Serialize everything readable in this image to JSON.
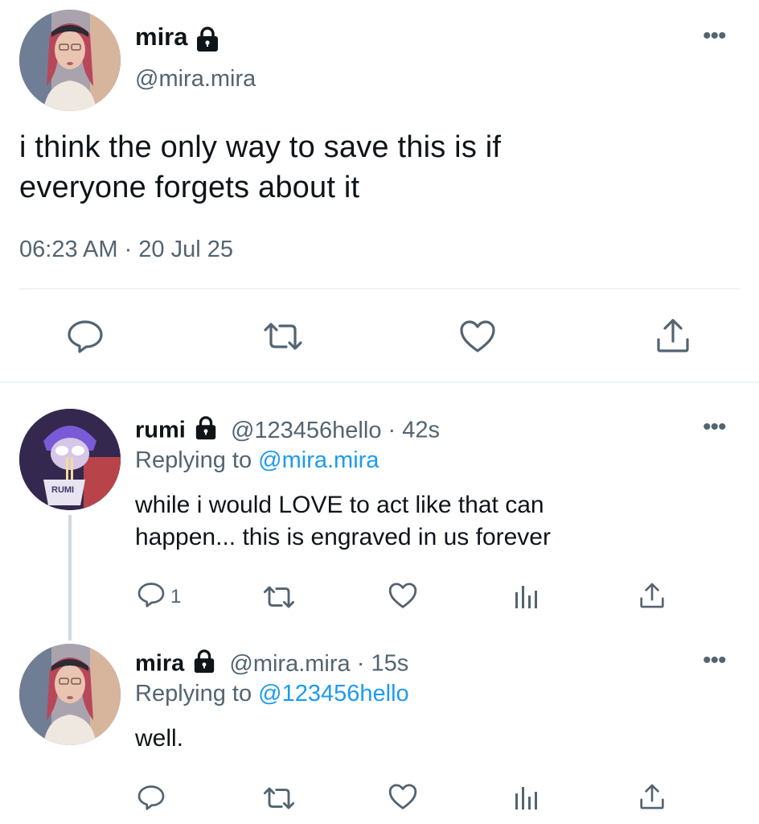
{
  "main_tweet": {
    "name": "mira",
    "handle": "@mira.mira",
    "text_line1": "i think the only way to save this is if",
    "text_line2": "everyone forgets about it",
    "timestamp": "06:23 AM · 20 Jul 25",
    "more": "•••",
    "icons": [
      "reply-icon",
      "retweet-icon",
      "like-icon",
      "share-icon"
    ]
  },
  "replies": [
    {
      "name": "rumi",
      "handle": "@123456hello",
      "time": "· 42s",
      "replying_prefix": "Replying to ",
      "replying_to": "@mira.mira",
      "text_line1": "while i would LOVE to act like that can",
      "text_line2": "happen... this is engraved in us forever",
      "reply_count": "1",
      "more": "•••",
      "avatar_label": "RUMI"
    },
    {
      "name": "mira",
      "handle": "@mira.mira",
      "time": "· 15s",
      "replying_prefix": "Replying to ",
      "replying_to": "@123456hello",
      "text_line1": "well.",
      "more": "•••"
    }
  ],
  "colors": {
    "accent": "#1d9bf0",
    "secondary_text": "#536471",
    "primary_text": "#0f1419",
    "divider": "#eff3f4"
  }
}
